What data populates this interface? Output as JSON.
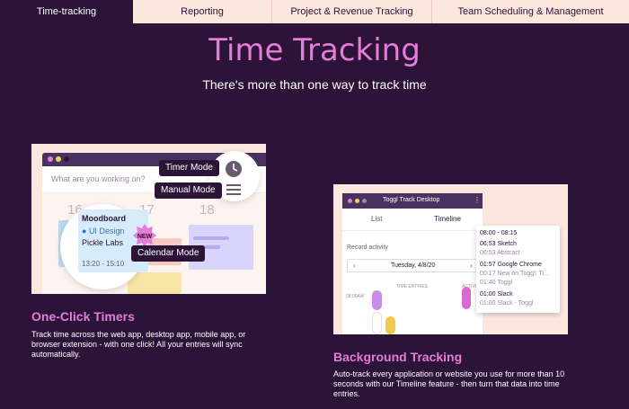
{
  "tabs": [
    {
      "label": "Time-tracking",
      "active": true
    },
    {
      "label": "Reporting",
      "active": false
    },
    {
      "label": "Project & Revenue Tracking",
      "active": false
    },
    {
      "label": "Team Scheduling & Management",
      "active": false
    }
  ],
  "hero": {
    "title": "Time Tracking",
    "subtitle": "There's more than one way to track time"
  },
  "left_card": {
    "search_placeholder": "What are you working on?",
    "day_numbers": [
      "16",
      "17",
      "18"
    ],
    "timer_mode": "Timer Mode",
    "manual_mode": "Manual Mode",
    "calendar_mode": "Calendar Mode",
    "entry": {
      "title": "Moodboard",
      "project": "UI Design",
      "client": "Pickle Labs",
      "time": "13:20 - 15:10"
    },
    "new_badge": "NEW",
    "heading": "One-Click Timers",
    "description": "Track time across the web app, desktop app, mobile app, or browser extension - with one click! All your entries will sync automatically."
  },
  "right_card": {
    "window_title": "Toggl Track Desktop",
    "tab_list": "List",
    "tab_timeline": "Timeline",
    "record_activity": "Record activity",
    "date": "Tuesday, 4/8/20",
    "time_entries_label": "TIME ENTRIES",
    "activity_label": "ACTIVITY",
    "time_axis": "08:00AM",
    "popup": [
      {
        "text": "08:00 - 08:15",
        "style": "muted"
      },
      {
        "text": "06:53 Sketch",
        "style": "strong"
      },
      {
        "text": "06:53 Abstract",
        "style": "muted"
      },
      {
        "text": "01:57 Google Chrome",
        "style": "strong"
      },
      {
        "text": "00:17 New on Toggl: Ti...",
        "style": "muted"
      },
      {
        "text": "01:40 Toggl",
        "style": "muted"
      },
      {
        "text": "01:00 Slack",
        "style": "strong"
      },
      {
        "text": "01:00 Slack - Toggl",
        "style": "muted"
      }
    ],
    "heading": "Background Tracking",
    "description": "Auto-track every application or website you use for more than 10 seconds with our Timeline feature - then turn that data into time entries."
  },
  "colors": {
    "background": "#2c1338",
    "accent": "#e57cd8",
    "tab_bg": "#fce7df"
  }
}
